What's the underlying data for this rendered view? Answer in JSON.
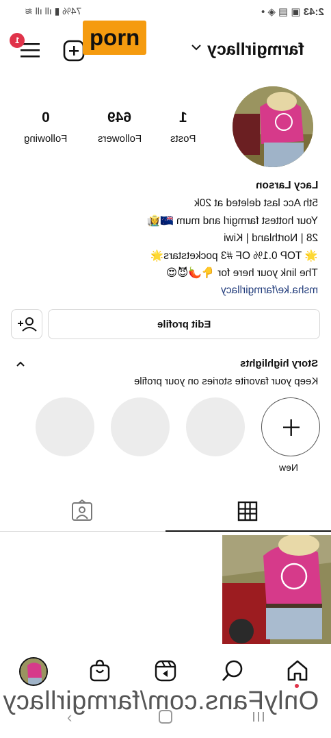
{
  "status_bar": {
    "time": "2:43",
    "battery": "74%"
  },
  "header": {
    "username": "farmgirllacy",
    "notification_count": "1",
    "overlay_tag": "porn"
  },
  "profile": {
    "stats": {
      "posts_count": "1",
      "posts_label": "Posts",
      "followers_count": "649",
      "followers_label": "Followers",
      "following_count": "0",
      "following_label": "Following"
    },
    "name": "Lacy Larson",
    "bio_lines": [
      "5th Acc last deleted at 20k",
      "Your hottest farmgirl and mum 🇳🇿👩‍🌾",
      "28 | Northland | Kiwi",
      "🌟 TOP 0.1% OF #3 pocketstars🌟",
      "The link your here for 👇🌶️😈😍"
    ],
    "link": "msha.ke/farmgirllacy",
    "edit_profile_label": "Edit profile"
  },
  "highlights": {
    "title": "Story highlights",
    "subtitle": "Keep your favorite stories on your profile",
    "new_label": "New"
  },
  "watermark": "OnlyFans.com/farmgirllacy",
  "colors": {
    "badge": "#e0334a",
    "overlay_tag_bg": "#f59b0f",
    "link": "#1f3a7a",
    "pink_shirt": "#d63a8a"
  },
  "icons": {
    "menu": "hamburger-icon",
    "create": "plus-square-icon",
    "chevron": "chevron-down-icon",
    "add_user": "add-person-icon",
    "collapse": "chevron-up-icon",
    "grid": "grid-icon",
    "tagged": "tagged-person-icon",
    "home": "home-icon",
    "search": "search-icon",
    "reels": "reels-icon",
    "shop": "shopping-bag-icon"
  }
}
